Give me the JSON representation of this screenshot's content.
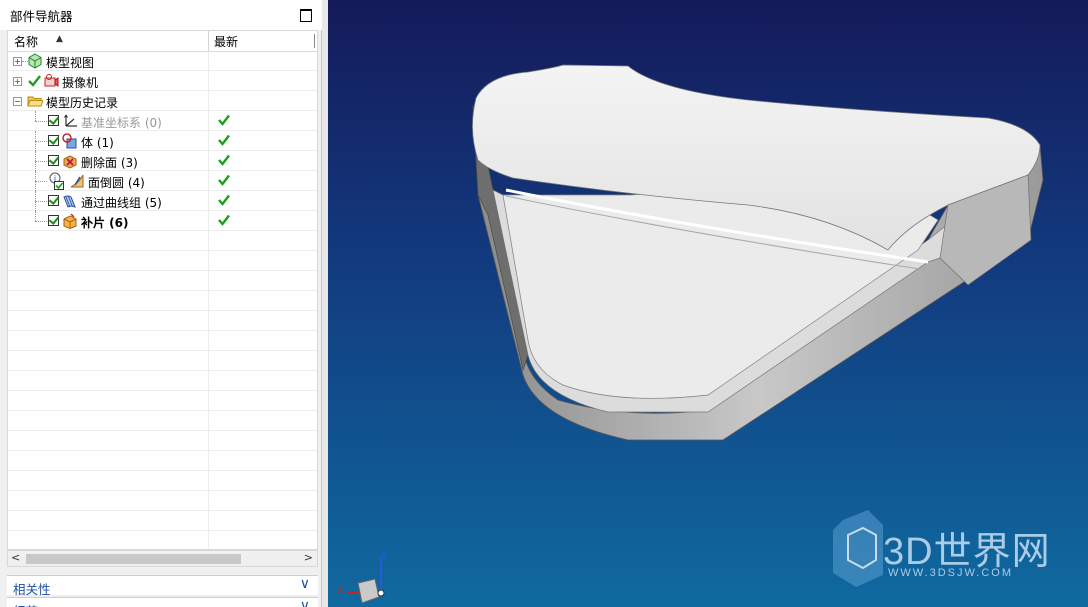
{
  "navigator": {
    "title": "部件导航器",
    "columns": {
      "name": "名称",
      "latest": "最新"
    },
    "items": [
      {
        "label": "模型视图",
        "level": 0,
        "expander": "+",
        "icon": "model-view-icon"
      },
      {
        "label": "摄像机",
        "level": 0,
        "expander": "+",
        "icon": "camera-icon",
        "status": "checked"
      },
      {
        "label": "模型历史记录",
        "level": 0,
        "expander": "-",
        "icon": "folder-icon"
      },
      {
        "label": "基准坐标系 (0)",
        "level": 1,
        "icon": "datum-csys-icon",
        "checkbox": true,
        "latest": true,
        "greyed": true
      },
      {
        "label": "体 (1)",
        "level": 1,
        "icon": "body-icon",
        "checkbox": true,
        "latest": true
      },
      {
        "label": "删除面 (3)",
        "level": 1,
        "icon": "delete-face-icon",
        "checkbox": true,
        "latest": true
      },
      {
        "label": "面倒圆 (4)",
        "level": 1,
        "icon": "face-blend-icon",
        "checkbox": false,
        "latest": true,
        "info": true
      },
      {
        "label": "通过曲线组 (5)",
        "level": 1,
        "icon": "through-curves-icon",
        "checkbox": true,
        "latest": true
      },
      {
        "label": "补片 (6)",
        "level": 1,
        "icon": "patch-icon",
        "checkbox": true,
        "latest": true,
        "bold": true
      }
    ]
  },
  "panels": {
    "dependencies": "相关性",
    "details": "细节"
  },
  "watermark": {
    "brand": "3D世界网",
    "url": "WWW.3DSJW.COM"
  },
  "triad": {
    "x": "X",
    "z": "Z"
  },
  "colors": {
    "check": "#1aa01a",
    "link": "#1e4fa8",
    "bg_top": "#141a5a",
    "bg_bottom": "#0f6aa0"
  }
}
